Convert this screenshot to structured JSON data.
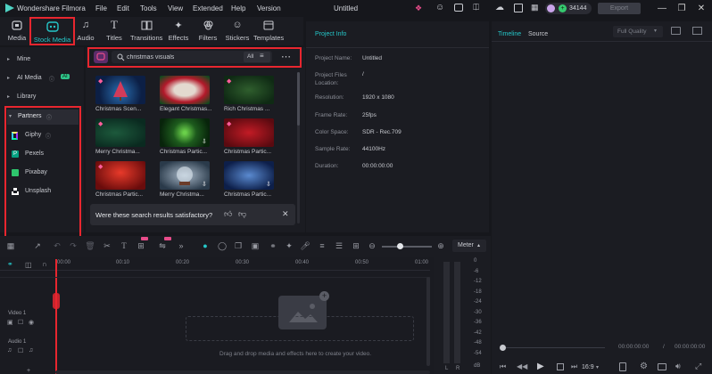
{
  "titlebar": {
    "app_name": "Wondershare Filmora",
    "menu": [
      "File",
      "Edit",
      "Tools",
      "View",
      "Extended",
      "Help",
      "Version"
    ],
    "doc_title": "Untitled",
    "credits": "34144",
    "export_label": "Export"
  },
  "media_tabs": [
    "Media",
    "Stock Media",
    "Audio",
    "Titles",
    "Transitions",
    "Effects",
    "Filters",
    "Stickers",
    "Templates"
  ],
  "leftnav": {
    "mine": "Mine",
    "ai_media": "AI Media",
    "ai_badge": "AI",
    "library": "Library",
    "partners": "Partners",
    "partner_items": [
      "Giphy",
      "Pexels",
      "Pixabay",
      "Unsplash"
    ]
  },
  "search": {
    "value": "christmas visuals",
    "filter_label": "All"
  },
  "results": [
    "Christmas Scen...",
    "Elegant Christmas...",
    "Rich Christmas ...",
    "Merry Christma...",
    "Christmas Partic...",
    "Christmas Partic...",
    "Christmas Partic...",
    "Merry Christma...",
    "Christmas Partic..."
  ],
  "feedback": {
    "question": "Were these search results satisfactory?"
  },
  "project_info": {
    "title": "Project Info",
    "rows": [
      {
        "key": "Project Name:",
        "value": "Untitled"
      },
      {
        "key": "Project Files Location:",
        "value": "/"
      },
      {
        "key": "Resolution:",
        "value": "1920 x 1080"
      },
      {
        "key": "Frame Rate:",
        "value": "25fps"
      },
      {
        "key": "Color Space:",
        "value": "SDR - Rec.709"
      },
      {
        "key": "Sample Rate:",
        "value": "44100Hz"
      },
      {
        "key": "Duration:",
        "value": "00:00:00:00"
      }
    ]
  },
  "preview": {
    "tab_timeline": "Timeline",
    "tab_source": "Source",
    "quality": "Full Quality",
    "time_current": "00:00:00:00",
    "time_total": "00:00:00:00",
    "aspect": "16:9"
  },
  "timeline": {
    "meter_label": "Meter",
    "ruler": [
      "00:00",
      "00:10",
      "00:20",
      "00:30",
      "00:40",
      "00:50",
      "01:00"
    ],
    "db_scale": [
      "0",
      "-6",
      "-12",
      "-18",
      "-24",
      "-30",
      "-36",
      "-42",
      "-48",
      "-54",
      "dB"
    ],
    "lr": [
      "L",
      "R"
    ],
    "video_track": "Video 1",
    "audio_track": "Audio 1",
    "drop_hint": "Drag and drop media and effects here to create your video."
  },
  "colors": {
    "accent": "#25c7c9",
    "highlight_red": "#e8262f",
    "pink": "#e84c8a",
    "bg": "#16171c"
  }
}
